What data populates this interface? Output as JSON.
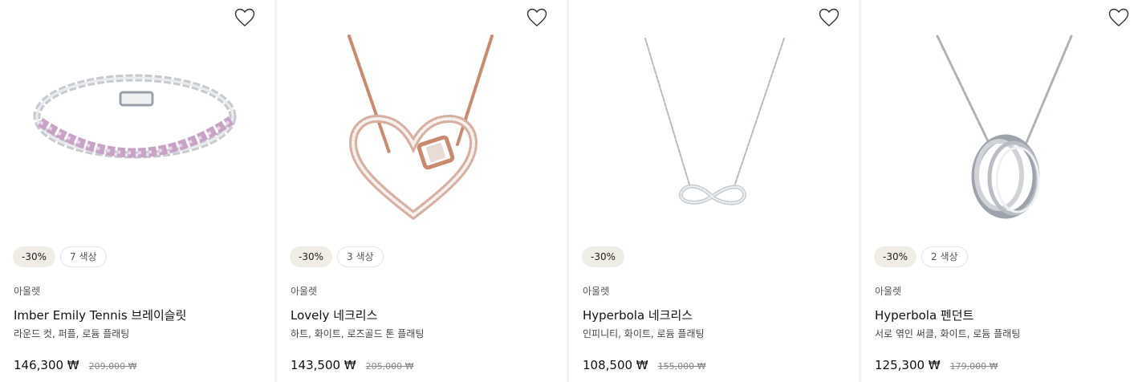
{
  "colors": {
    "badge_discount_bg": "#efede6",
    "gold": "#c98a6e",
    "silver": "#c8cdd2",
    "pink_stone": "#c9a3c6"
  },
  "products": [
    {
      "image_icon": "tennis-bracelet-image",
      "discount": "-30%",
      "colors_count": "7 색상",
      "category": "아울렛",
      "title": "Imber Emily Tennis 브레이슬릿",
      "description": "라운드 컷, 퍼플, 로듐 플래팅",
      "price_now": "146,300 ₩",
      "price_was": "209,000 ₩"
    },
    {
      "image_icon": "heart-necklace-image",
      "discount": "-30%",
      "colors_count": "3 색상",
      "category": "아울렛",
      "title": "Lovely 네크리스",
      "description": "하트, 화이트, 로즈골드 톤 플래팅",
      "price_now": "143,500 ₩",
      "price_was": "205,000 ₩"
    },
    {
      "image_icon": "infinity-necklace-image",
      "discount": "-30%",
      "colors_count": "",
      "category": "아울렛",
      "title": "Hyperbola 네크리스",
      "description": "인피니티, 화이트, 로듐 플래팅",
      "price_now": "108,500 ₩",
      "price_was": "155,000 ₩"
    },
    {
      "image_icon": "ring-pendant-image",
      "discount": "-30%",
      "colors_count": "2 색상",
      "category": "아울렛",
      "title": "Hyperbola 펜던트",
      "description": "서로 엮인 써클, 화이트, 로듐 플래팅",
      "price_now": "125,300 ₩",
      "price_was": "179,000 ₩"
    }
  ]
}
